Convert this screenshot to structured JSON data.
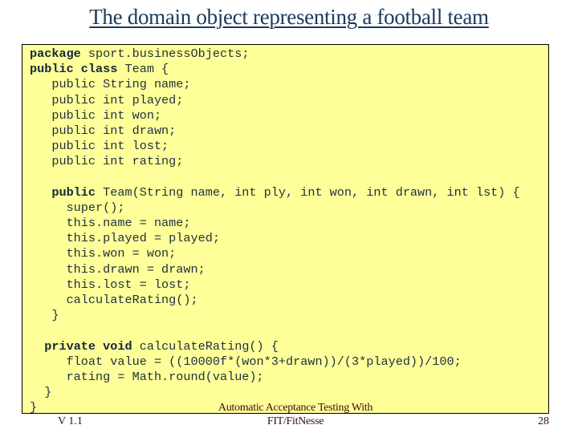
{
  "slide": {
    "title": "The domain object representing a football team",
    "footer": {
      "version": "V 1.1",
      "center_line1": "Automatic Acceptance Testing With",
      "center_line2": "FIT/FitNesse",
      "page_number": "28"
    }
  },
  "code": {
    "lines": [
      {
        "kw": "package",
        "rest": " sport.businessObjects;"
      },
      {
        "kw": "public class",
        "rest": " Team {"
      },
      {
        "kw": "",
        "rest": "   public String name;"
      },
      {
        "kw": "",
        "rest": "   public int played;"
      },
      {
        "kw": "",
        "rest": "   public int won;"
      },
      {
        "kw": "",
        "rest": "   public int drawn;"
      },
      {
        "kw": "",
        "rest": "   public int lost;"
      },
      {
        "kw": "",
        "rest": "   public int rating;"
      },
      {
        "kw": "",
        "rest": ""
      },
      {
        "indent": "   ",
        "kw": "public",
        "rest": " Team(String name, int ply, int won, int drawn, int lst) {"
      },
      {
        "kw": "",
        "rest": "     super();"
      },
      {
        "kw": "",
        "rest": "     this.name = name;"
      },
      {
        "kw": "",
        "rest": "     this.played = played;"
      },
      {
        "kw": "",
        "rest": "     this.won = won;"
      },
      {
        "kw": "",
        "rest": "     this.drawn = drawn;"
      },
      {
        "kw": "",
        "rest": "     this.lost = lost;"
      },
      {
        "kw": "",
        "rest": "     calculateRating();"
      },
      {
        "kw": "",
        "rest": "   }"
      },
      {
        "kw": "",
        "rest": ""
      },
      {
        "indent": "  ",
        "kw": "private void",
        "rest": " calculateRating() {"
      },
      {
        "kw": "",
        "rest": "     float value = ((10000f*(won*3+drawn))/(3*played))/100;"
      },
      {
        "kw": "",
        "rest": "     rating = Math.round(value);"
      },
      {
        "kw": "",
        "rest": "  }"
      },
      {
        "kw": "",
        "rest": "}"
      }
    ]
  }
}
